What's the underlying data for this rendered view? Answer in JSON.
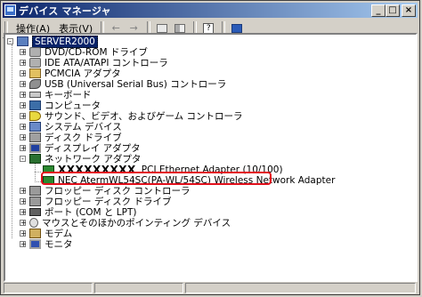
{
  "window": {
    "title": "デバイス マネージャ"
  },
  "titlebar_buttons": {
    "minimize": "_",
    "maximize": "□",
    "close": "×"
  },
  "menu": {
    "action": "操作(A)",
    "view": "表示(V)"
  },
  "toolbar": {
    "back_glyph": "←",
    "forward_glyph": "→",
    "help_glyph": "?"
  },
  "tree": {
    "root": "SERVER2000",
    "categories": [
      {
        "label": "DVD/CD-ROM ドライブ",
        "icon": "disk-icon"
      },
      {
        "label": "IDE ATA/ATAPI コントローラ",
        "icon": "disk-icon"
      },
      {
        "label": "PCMCIA アダプタ",
        "icon": "card-icon"
      },
      {
        "label": "USB (Universal Serial Bus) コントローラ",
        "icon": "usb-icon"
      },
      {
        "label": "キーボード",
        "icon": "keyboard-icon"
      },
      {
        "label": "コンピュータ",
        "icon": "cpu-icon"
      },
      {
        "label": "サウンド、ビデオ、およびゲーム コントローラ",
        "icon": "sound-icon"
      },
      {
        "label": "システム デバイス",
        "icon": "system-icon"
      },
      {
        "label": "ディスク ドライブ",
        "icon": "drive-icon"
      },
      {
        "label": "ディスプレイ アダプタ",
        "icon": "display-icon"
      },
      {
        "label": "ネットワーク アダプタ",
        "icon": "network-adapter-icon"
      }
    ],
    "network_children": [
      {
        "name": "XXXXXXXXX",
        "label": "PCI Ethernet Adapter (10/100)"
      },
      {
        "label": "NEC AtermWL54SC(PA-WL/54SC) Wireless Network Adapter"
      }
    ],
    "categories_after": [
      {
        "label": "フロッピー ディスク コントローラ",
        "icon": "floppy-icon"
      },
      {
        "label": "フロッピー ディスク ドライブ",
        "icon": "floppy-icon"
      },
      {
        "label": "ポート (COM と LPT)",
        "icon": "port-icon"
      },
      {
        "label": "マウスとそのほかのポインティング デバイス",
        "icon": "mouse-icon"
      },
      {
        "label": "モデム",
        "icon": "modem-icon"
      },
      {
        "label": "モニタ",
        "icon": "monitor-icon"
      }
    ]
  },
  "colors": {
    "titlebar_start": "#0a246a",
    "titlebar_end": "#a6caf0",
    "highlight_border": "#e2101c"
  }
}
